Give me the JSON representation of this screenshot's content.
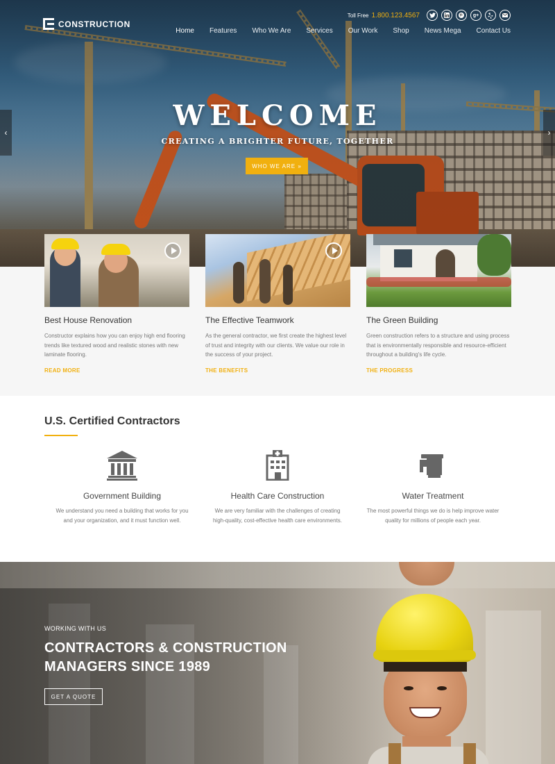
{
  "header": {
    "logo_text": "CONSTRUCTION",
    "toll_free_label": "Toll Free",
    "toll_free_number": "1.800.123.4567",
    "social": [
      "twitter-icon",
      "linkedin-icon",
      "pinterest-icon",
      "google-plus-icon",
      "yelp-icon",
      "email-icon"
    ],
    "nav": [
      "Home",
      "Features",
      "Who We Are",
      "Services",
      "Our Work",
      "Shop",
      "News Mega",
      "Contact Us"
    ],
    "active_nav": "Home"
  },
  "hero": {
    "title": "WELCOME",
    "subtitle": "CREATING A BRIGHTER FUTURE, TOGETHER",
    "button": "WHO WE ARE »",
    "arrow_left": "‹",
    "arrow_right": "›"
  },
  "cards": [
    {
      "title": "Best House Renovation",
      "text": "Constructor explains how you can enjoy high end flooring trends like textured wood and realistic stones with new laminate flooring.",
      "link": "READ MORE"
    },
    {
      "title": "The Effective Teamwork",
      "text": "As the general contractor, we first create the highest level of trust and integrity with our clients. We value our role in the success of your project.",
      "link": "THE BENEFITS"
    },
    {
      "title": "The Green Building",
      "text": "Green construction refers to a structure and using process that is environmentally responsible and resource-efficient throughout a building's life cycle.",
      "link": "THE PROGRESS"
    }
  ],
  "certified": {
    "title": "U.S. Certified Contractors",
    "services": [
      {
        "icon": "government-building-icon",
        "title": "Government Building",
        "text": "We understand you need a building that works for you and your organization, and it must function well."
      },
      {
        "icon": "hospital-icon",
        "title": "Health Care Construction",
        "text": "We are very familiar with the challenges of creating high-quality, cost-effective health care environments."
      },
      {
        "icon": "water-tap-icon",
        "title": "Water Treatment",
        "text": "The most powerful things we do is help improve water quality for millions of people each year."
      }
    ]
  },
  "banner": {
    "eyebrow": "WORKING WITH US",
    "heading": "CONTRACTORS & CONSTRUCTION MANAGERS SINCE 1989",
    "button": "GET A QUOTE"
  },
  "colors": {
    "accent": "#f1b00f",
    "card_bg": "#f6f6f6"
  }
}
